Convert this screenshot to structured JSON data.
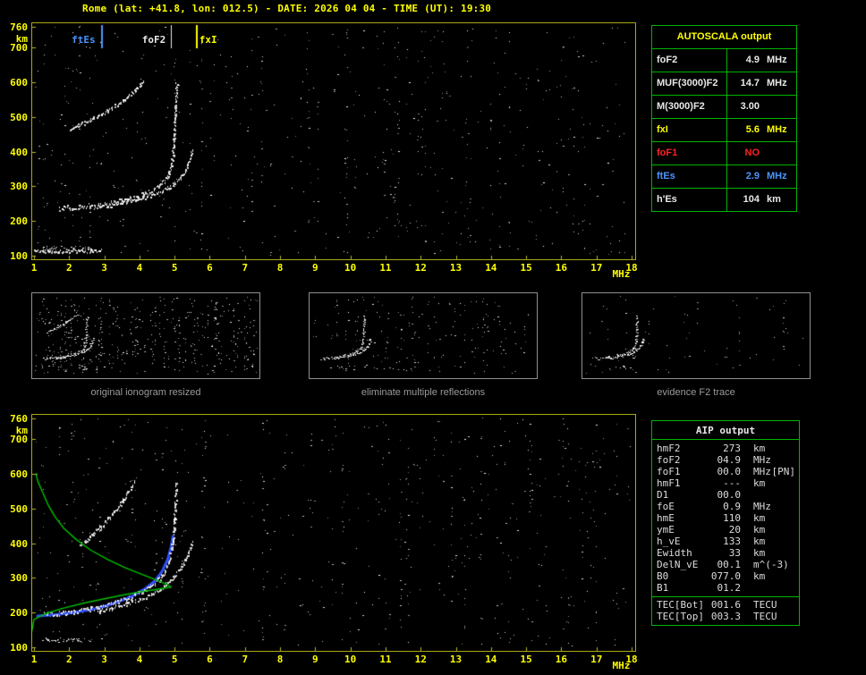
{
  "title": "Rome (lat: +41.8, lon: 012.5) - DATE: 2026 04 04 - TIME (UT): 19:30",
  "colors": {
    "background": "#000000",
    "title_yellow": "#ffff00",
    "axis_border": "#a8a816",
    "tick_yellow": "#ffff00",
    "table_border_green": "#00b400",
    "caption_gray": "#9a9a9a",
    "profile_green": "#00c000",
    "restored_trace_blue": "#3050ff",
    "ftes_blue": "#4d94ff",
    "fof1_red": "#ff2222",
    "trace_white": "#e8e8e8"
  },
  "autoscala_table": {
    "title": "AUTOSCALA output",
    "rows": [
      {
        "param": "foF2",
        "value": "4.9",
        "unit": "MHz",
        "color": "#e8e8e8"
      },
      {
        "param": "MUF(3000)F2",
        "value": "14.7",
        "unit": "MHz",
        "color": "#e8e8e8"
      },
      {
        "param": "M(3000)F2",
        "value": "3.00",
        "unit": "",
        "color": "#e8e8e8"
      },
      {
        "param": "fxI",
        "value": "5.6",
        "unit": "MHz",
        "color": "#ffff00"
      },
      {
        "param": "foF1",
        "value": "NO",
        "unit": "",
        "color": "#ff2222"
      },
      {
        "param": "ftEs",
        "value": "2.9",
        "unit": "MHz",
        "color": "#4d94ff"
      },
      {
        "param": "h'Es",
        "value": "104",
        "unit": "km",
        "color": "#e8e8e8"
      }
    ]
  },
  "thumbnails": [
    {
      "caption": "original ionogram resized"
    },
    {
      "caption": "eliminate multiple reflections"
    },
    {
      "caption": "evidence F2 trace"
    }
  ],
  "aip_table": {
    "title": "AIP output",
    "rows": [
      {
        "param": "hmF2",
        "value": "273",
        "unit": "km",
        "note": ""
      },
      {
        "param": "foF2",
        "value": "04.9",
        "unit": "MHz",
        "note": ""
      },
      {
        "param": "foF1",
        "value": "00.0",
        "unit": "MHz",
        "note": "[PN]"
      },
      {
        "param": "hmF1",
        "value": "---",
        "unit": "km",
        "note": ""
      },
      {
        "param": "D1",
        "value": "00.0",
        "unit": "",
        "note": ""
      },
      {
        "param": "foE",
        "value": "0.9",
        "unit": "MHz",
        "note": ""
      },
      {
        "param": "hmE",
        "value": "110",
        "unit": "km",
        "note": ""
      },
      {
        "param": "ymE",
        "value": "20",
        "unit": "km",
        "note": ""
      },
      {
        "param": "h_vE",
        "value": "133",
        "unit": "km",
        "note": ""
      },
      {
        "param": "Ewidth",
        "value": "33",
        "unit": "km",
        "note": ""
      },
      {
        "param": "DelN_vE",
        "value": "00.1",
        "unit": "m^(-3)",
        "note": ""
      },
      {
        "param": "B0",
        "value": "077.0",
        "unit": "km",
        "note": ""
      },
      {
        "param": "B1",
        "value": "01.2",
        "unit": "",
        "note": ""
      }
    ],
    "tec_rows": [
      {
        "param": "TEC[Bot]",
        "value": "001.6",
        "unit": "TECU"
      },
      {
        "param": "TEC[Top]",
        "value": "003.3",
        "unit": "TECU"
      }
    ]
  },
  "chart_data": [
    {
      "id": "scaled-ionogram",
      "type": "scatter",
      "title": "",
      "xlabel": "MHz",
      "ylabel": "km",
      "xlim": [
        1,
        18
      ],
      "ylim": [
        100,
        760
      ],
      "x_ticks": [
        1,
        2,
        3,
        4,
        5,
        6,
        7,
        8,
        9,
        10,
        11,
        12,
        13,
        14,
        15,
        16,
        17,
        18
      ],
      "y_ticks": [
        760,
        700,
        600,
        500,
        400,
        300,
        200,
        100
      ],
      "markers": [
        {
          "label": "ftEs",
          "freq_mhz": 2.9,
          "color": "#4d94ff"
        },
        {
          "label": "foF2",
          "freq_mhz": 4.9,
          "color": "#e8e8e8"
        },
        {
          "label": "fxI",
          "freq_mhz": 5.6,
          "color": "#ffff00"
        }
      ],
      "series": [
        {
          "name": "F2-ordinary-trace",
          "points": [
            [
              1.7,
              238
            ],
            [
              2.0,
              240
            ],
            [
              2.3,
              243
            ],
            [
              2.6,
              246
            ],
            [
              2.9,
              250
            ],
            [
              3.2,
              255
            ],
            [
              3.5,
              261
            ],
            [
              3.8,
              269
            ],
            [
              4.1,
              278
            ],
            [
              4.35,
              289
            ],
            [
              4.55,
              302
            ],
            [
              4.7,
              317
            ],
            [
              4.8,
              334
            ],
            [
              4.88,
              355
            ],
            [
              4.93,
              380
            ],
            [
              4.96,
              410
            ],
            [
              4.98,
              445
            ],
            [
              5.0,
              485
            ],
            [
              5.02,
              525
            ],
            [
              5.04,
              565
            ],
            [
              5.05,
              600
            ]
          ]
        },
        {
          "name": "F2-extraordinary-trace",
          "points": [
            [
              2.7,
              240
            ],
            [
              3.1,
              246
            ],
            [
              3.5,
              253
            ],
            [
              3.9,
              262
            ],
            [
              4.3,
              274
            ],
            [
              4.65,
              289
            ],
            [
              4.95,
              306
            ],
            [
              5.15,
              325
            ],
            [
              5.3,
              347
            ],
            [
              5.4,
              370
            ],
            [
              5.47,
              392
            ],
            [
              5.5,
              405
            ]
          ]
        },
        {
          "name": "second-order-reflection",
          "points": [
            [
              2.0,
              465
            ],
            [
              2.4,
              483
            ],
            [
              2.8,
              503
            ],
            [
              3.2,
              526
            ],
            [
              3.6,
              553
            ],
            [
              3.9,
              580
            ],
            [
              4.1,
              605
            ]
          ]
        },
        {
          "name": "Es-trace",
          "points": [
            [
              1.0,
              114
            ],
            [
              1.4,
              114
            ],
            [
              1.8,
              115
            ],
            [
              2.2,
              115
            ],
            [
              2.6,
              116
            ],
            [
              2.9,
              116
            ]
          ]
        }
      ]
    },
    {
      "id": "profile-ionogram",
      "type": "scatter",
      "title": "",
      "xlabel": "MHz",
      "ylabel": "km",
      "xlim": [
        1,
        18
      ],
      "ylim": [
        100,
        760
      ],
      "x_ticks": [
        1,
        2,
        3,
        4,
        5,
        6,
        7,
        8,
        9,
        10,
        11,
        12,
        13,
        14,
        15,
        16,
        17,
        18
      ],
      "y_ticks": [
        760,
        700,
        600,
        500,
        400,
        300,
        200,
        100
      ],
      "series": [
        {
          "name": "F2-ordinary-trace",
          "points": [
            [
              1.3,
              196
            ],
            [
              1.7,
              199
            ],
            [
              2.1,
              203
            ],
            [
              2.5,
              210
            ],
            [
              2.9,
              219
            ],
            [
              3.3,
              230
            ],
            [
              3.7,
              244
            ],
            [
              4.0,
              259
            ],
            [
              4.3,
              277
            ],
            [
              4.55,
              297
            ],
            [
              4.7,
              319
            ],
            [
              4.82,
              346
            ],
            [
              4.9,
              379
            ],
            [
              4.95,
              416
            ],
            [
              4.98,
              456
            ],
            [
              5.0,
              500
            ],
            [
              5.02,
              544
            ],
            [
              5.04,
              580
            ]
          ]
        },
        {
          "name": "F2-extraordinary-trace",
          "points": [
            [
              2.8,
              206
            ],
            [
              3.2,
              214
            ],
            [
              3.6,
              225
            ],
            [
              4.0,
              239
            ],
            [
              4.4,
              257
            ],
            [
              4.7,
              279
            ],
            [
              4.95,
              302
            ],
            [
              5.15,
              327
            ],
            [
              5.3,
              354
            ],
            [
              5.4,
              381
            ],
            [
              5.47,
              405
            ]
          ]
        },
        {
          "name": "second-order-reflection",
          "points": [
            [
              2.3,
              395
            ],
            [
              2.7,
              430
            ],
            [
              3.1,
              470
            ],
            [
              3.5,
              520
            ],
            [
              3.85,
              578
            ]
          ]
        },
        {
          "name": "autoscala-restored-trace",
          "color": "#3050ff",
          "points": [
            [
              1.1,
              190
            ],
            [
              1.6,
              194
            ],
            [
              2.1,
              200
            ],
            [
              2.6,
              208
            ],
            [
              3.0,
              218
            ],
            [
              3.4,
              231
            ],
            [
              3.8,
              248
            ],
            [
              4.15,
              268
            ],
            [
              4.45,
              292
            ],
            [
              4.65,
              320
            ],
            [
              4.8,
              352
            ],
            [
              4.9,
              390
            ],
            [
              4.95,
              420
            ]
          ]
        },
        {
          "name": "electron-density-profile",
          "color": "#00c000",
          "points": [
            [
              0.9,
              125
            ],
            [
              1.0,
              180
            ],
            [
              1.3,
              196
            ],
            [
              1.8,
              212
            ],
            [
              2.4,
              227
            ],
            [
              3.0,
              240
            ],
            [
              3.6,
              252
            ],
            [
              4.1,
              261
            ],
            [
              4.5,
              267
            ],
            [
              4.8,
              272
            ],
            [
              4.9,
              273
            ],
            [
              4.8,
              281
            ],
            [
              4.5,
              293
            ],
            [
              4.1,
              309
            ],
            [
              3.6,
              329
            ],
            [
              3.1,
              353
            ],
            [
              2.6,
              381
            ],
            [
              2.2,
              411
            ],
            [
              1.85,
              443
            ],
            [
              1.6,
              476
            ],
            [
              1.4,
              511
            ],
            [
              1.25,
              546
            ],
            [
              1.12,
              576
            ],
            [
              1.05,
              600
            ]
          ]
        }
      ]
    }
  ]
}
